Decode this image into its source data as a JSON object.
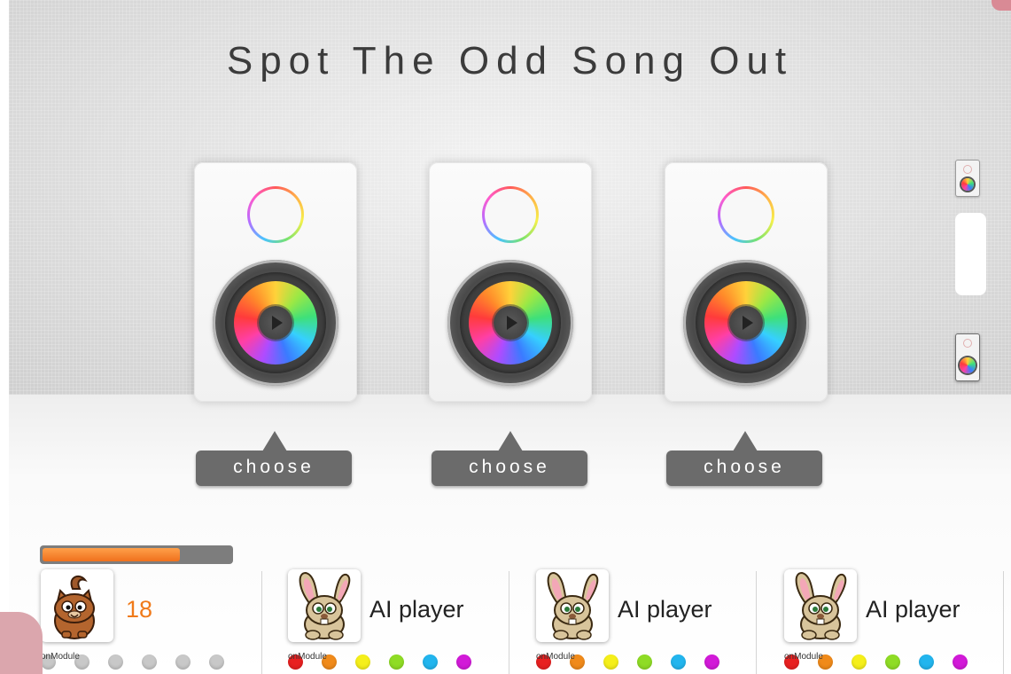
{
  "title": "Spot The Odd Song Out",
  "speakers": [
    {
      "choose_label": "choose"
    },
    {
      "choose_label": "choose"
    },
    {
      "choose_label": "choose"
    }
  ],
  "timer": {
    "progress_percent": 73,
    "color": "#f07a1a"
  },
  "players": [
    {
      "avatar": "cat-icon",
      "name": "",
      "score": "18",
      "dots_label": "onModule",
      "dots": [
        "#c8c8c8",
        "#c8c8c8",
        "#c8c8c8",
        "#c8c8c8",
        "#c8c8c8",
        "#c8c8c8"
      ]
    },
    {
      "avatar": "rabbit-icon",
      "name": "AI player",
      "score": "",
      "dots_label": "onModule",
      "dots": [
        "#e82020",
        "#f08a1a",
        "#f5ef1a",
        "#8fdc25",
        "#22b5ee",
        "#d21ad8"
      ]
    },
    {
      "avatar": "rabbit-icon",
      "name": "AI player",
      "score": "",
      "dots_label": "onModule",
      "dots": [
        "#e82020",
        "#f08a1a",
        "#f5ef1a",
        "#8fdc25",
        "#22b5ee",
        "#d21ad8"
      ]
    },
    {
      "avatar": "rabbit-icon",
      "name": "AI player",
      "score": "",
      "dots_label": "onModule",
      "dots": [
        "#e82020",
        "#f08a1a",
        "#f5ef1a",
        "#8fdc25",
        "#22b5ee",
        "#d21ad8"
      ]
    }
  ]
}
